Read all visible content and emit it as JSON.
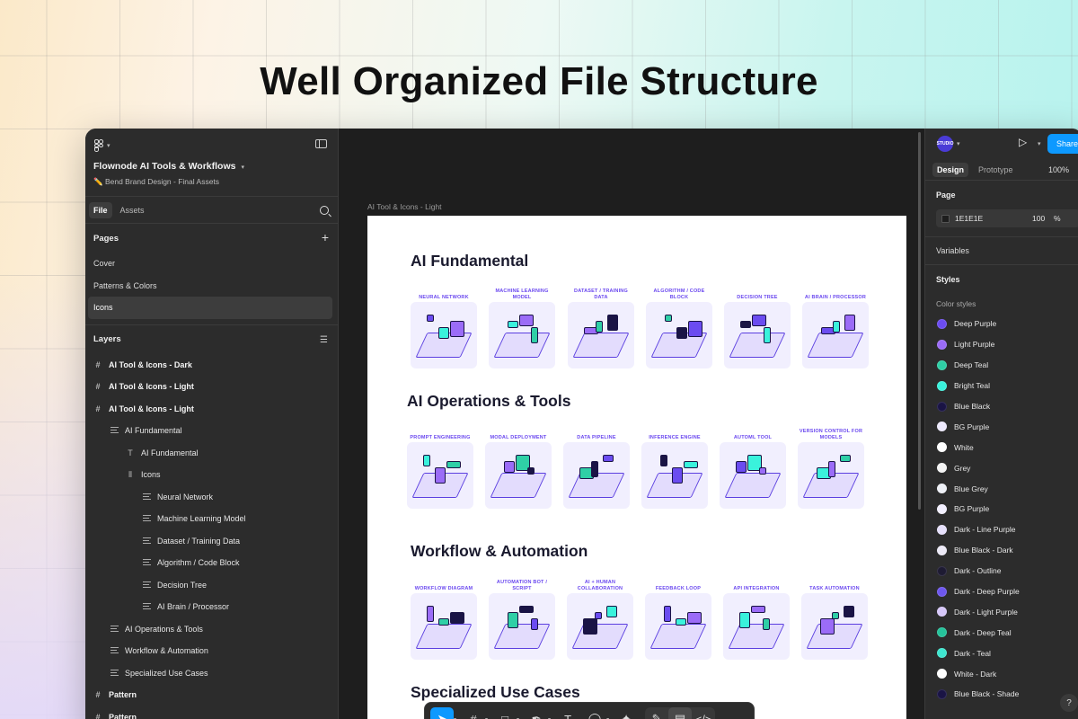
{
  "headline": "Well Organized File Structure",
  "left": {
    "project_title": "Flownode AI Tools & Workflows",
    "project_sub": "✏️ Bend Brand Design - Final Assets",
    "tabs": [
      "File",
      "Assets"
    ],
    "pages_label": "Pages",
    "pages": [
      "Cover",
      "Patterns & Colors",
      "Icons"
    ],
    "layers_label": "Layers",
    "layers": [
      {
        "label": "AI Tool & Icons - Dark",
        "icon": "frame-icon",
        "indent": 0
      },
      {
        "label": "AI Tool & Icons - Light",
        "icon": "frame-icon",
        "indent": 0
      },
      {
        "label": "AI Tool & Icons - Light",
        "icon": "frame-icon",
        "indent": 0
      },
      {
        "label": "AI Fundamental",
        "icon": "section-icon",
        "indent": 1
      },
      {
        "label": "AI Fundamental",
        "icon": "text-icon",
        "indent": 2
      },
      {
        "label": "Icons",
        "icon": "autolayout-icon",
        "indent": 2
      },
      {
        "label": "Neural Network",
        "icon": "section-icon",
        "indent": 3
      },
      {
        "label": "Machine Learning Model",
        "icon": "section-icon",
        "indent": 3
      },
      {
        "label": "Dataset / Training Data",
        "icon": "section-icon",
        "indent": 3
      },
      {
        "label": "Algorithm / Code Block",
        "icon": "section-icon",
        "indent": 3
      },
      {
        "label": "Decision Tree",
        "icon": "section-icon",
        "indent": 3
      },
      {
        "label": "AI Brain / Processor",
        "icon": "section-icon",
        "indent": 3
      },
      {
        "label": "AI Operations & Tools",
        "icon": "section-icon",
        "indent": 1
      },
      {
        "label": "Workflow & Automation",
        "icon": "section-icon",
        "indent": 1
      },
      {
        "label": "Specialized Use Cases",
        "icon": "section-icon",
        "indent": 1
      },
      {
        "label": "Pattern",
        "icon": "frame-icon",
        "indent": 0
      },
      {
        "label": "Pattern",
        "icon": "frame-icon",
        "indent": 0
      }
    ]
  },
  "canvas": {
    "frame_label": "AI Tool & Icons - Light",
    "sections": [
      {
        "title": "AI Fundamental",
        "cards": [
          "NEURAL NETWORK",
          "MACHINE LEARNING MODEL",
          "DATASET / TRAINING DATA",
          "ALGORITHM / CODE BLOCK",
          "DECISION TREE",
          "AI BRAIN / PROCESSOR"
        ]
      },
      {
        "title": "AI Operations & Tools",
        "cards": [
          "PROMPT ENGINEERING",
          "MODAL DEPLOYMENT",
          "DATA PIPELINE",
          "INFERENCE ENGINE",
          "AUTOML TOOL",
          "VERSION CONTROL FOR MODELS"
        ]
      },
      {
        "title": "Workflow & Automation",
        "cards": [
          "WORKFLOW DIAGRAM",
          "AUTOMATION BOT / SCRIPT",
          "AI + HUMAN COLLABORATION",
          "FEEDBACK LOOP",
          "API INTEGRATION",
          "TASK AUTOMATION"
        ]
      },
      {
        "title": "Specialized Use Cases",
        "cards": []
      }
    ]
  },
  "right": {
    "avatar": "STUDIO",
    "share": "Share",
    "tabs": [
      "Design",
      "Prototype"
    ],
    "zoom": "100%",
    "page_label": "Page",
    "page_fill_hex": "1E1E1E",
    "page_fill_opacity": "100",
    "page_fill_pct": "%",
    "variables_label": "Variables",
    "styles_label": "Styles",
    "color_styles_label": "Color styles",
    "color_styles": [
      {
        "name": "Deep Purple",
        "color": "#6b4cf0"
      },
      {
        "name": "Light Purple",
        "color": "#9b6cf7"
      },
      {
        "name": "Deep Teal",
        "color": "#2fcfa6"
      },
      {
        "name": "Bright Teal",
        "color": "#3af2dc"
      },
      {
        "name": "Blue Black",
        "color": "#1a1445"
      },
      {
        "name": "BG Purple",
        "color": "#ede9fd"
      },
      {
        "name": "White",
        "color": "#ffffff"
      },
      {
        "name": "Grey",
        "color": "#f4f4f4"
      },
      {
        "name": "Blue Grey",
        "color": "#eef0f6"
      },
      {
        "name": "BG Purple",
        "color": "#f3f0ff"
      },
      {
        "name": "Dark - Line Purple",
        "color": "#e6e0fb"
      },
      {
        "name": "Blue Black - Dark",
        "color": "#ece9f6"
      },
      {
        "name": "Dark - Outline",
        "color": "#1e1b33"
      },
      {
        "name": "Dark - Deep Purple",
        "color": "#6e57ee"
      },
      {
        "name": "Dark - Light Purple",
        "color": "#d6c7f9"
      },
      {
        "name": "Dark - Deep Teal",
        "color": "#25c39b"
      },
      {
        "name": "Dark - Teal",
        "color": "#3ee6cf"
      },
      {
        "name": "White - Dark",
        "color": "#ffffff"
      },
      {
        "name": "Blue Black - Shade",
        "color": "#1a1445"
      }
    ]
  },
  "toolbar": {
    "tools": [
      "move-icon",
      "frame-tool-icon",
      "shape-tool-icon",
      "pen-tool-icon",
      "text-tool-icon",
      "comment-tool-icon",
      "actions-icon",
      "draw-mode-icon",
      "design-mode-icon",
      "dev-mode-icon"
    ]
  },
  "help": "?"
}
